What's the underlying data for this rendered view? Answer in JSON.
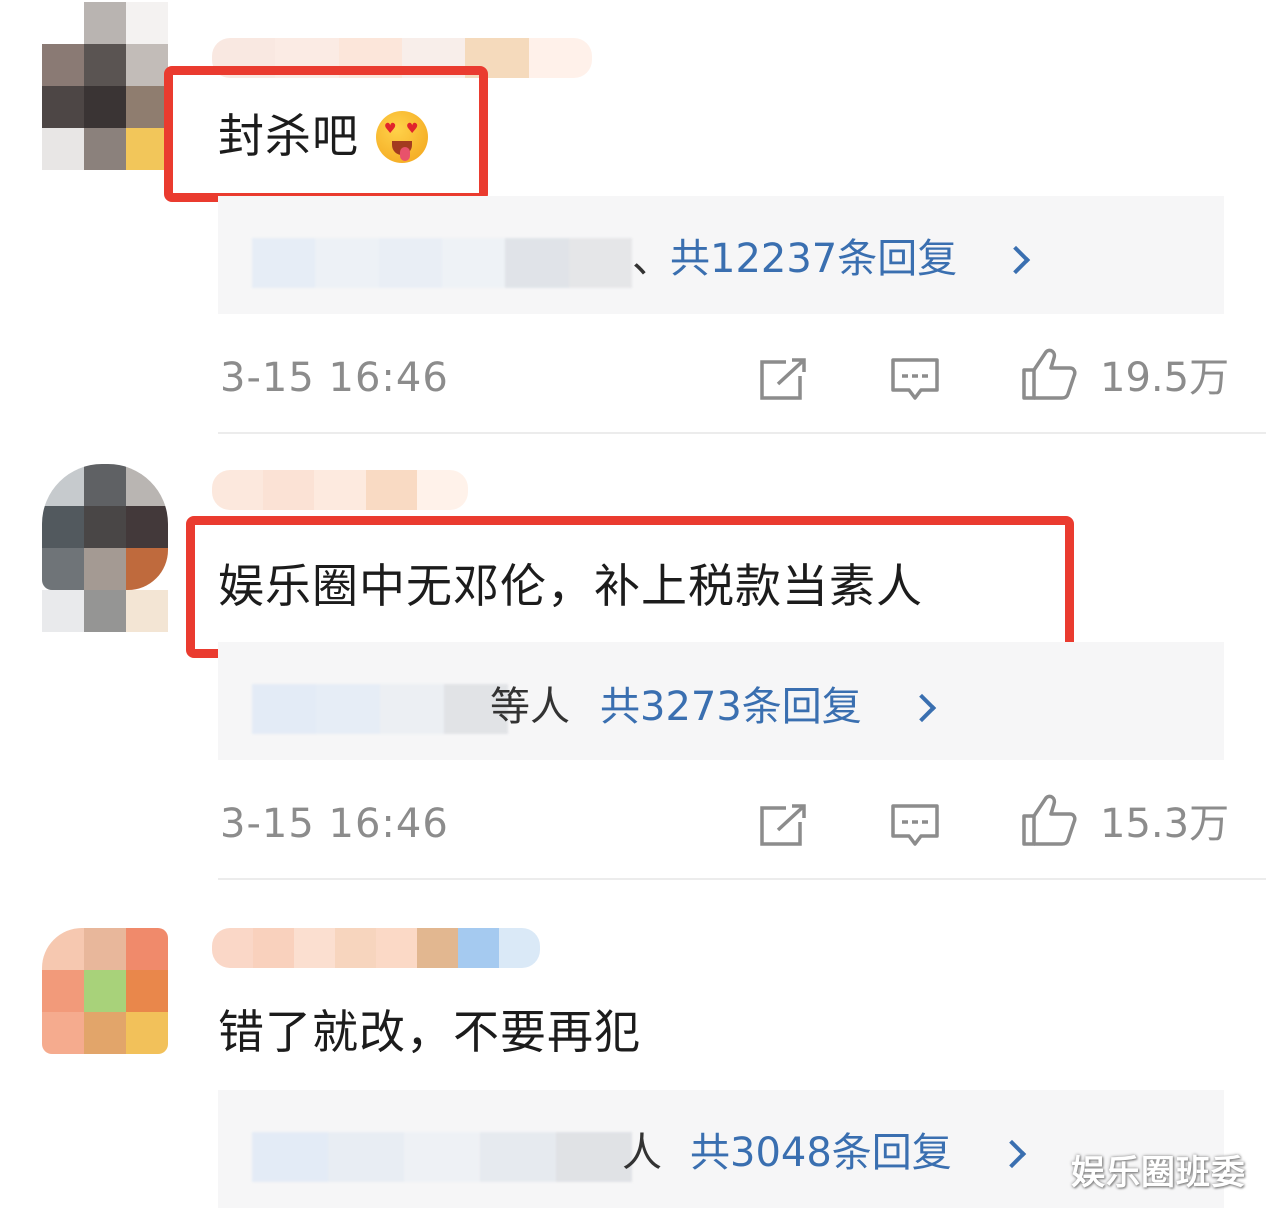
{
  "comments": [
    {
      "text": "封杀吧",
      "emoji_name": "heart-eyes-tongue-emoji",
      "reply_people": "、",
      "reply_total": "共12237条回复",
      "timestamp": "3-15 16:46",
      "likes": "19.5万",
      "highlighted": true
    },
    {
      "text": "娱乐圈中无邓伦，补上税款当素人",
      "reply_people": "等人",
      "reply_total": "共3273条回复",
      "timestamp": "3-15 16:46",
      "likes": "15.3万",
      "highlighted": true
    },
    {
      "text": "错了就改，不要再犯",
      "reply_people": "人",
      "reply_total": "共3048条回复",
      "highlighted": false
    }
  ],
  "watermark": "娱乐圈班委",
  "colors": {
    "highlight_border": "#ea3b2f",
    "reply_link": "#3a6fb0",
    "meta_text": "#8c8c8c",
    "reply_bg": "#f6f6f7"
  },
  "icons": [
    "share-icon",
    "comment-icon",
    "like-icon",
    "chevron-right-icon"
  ]
}
